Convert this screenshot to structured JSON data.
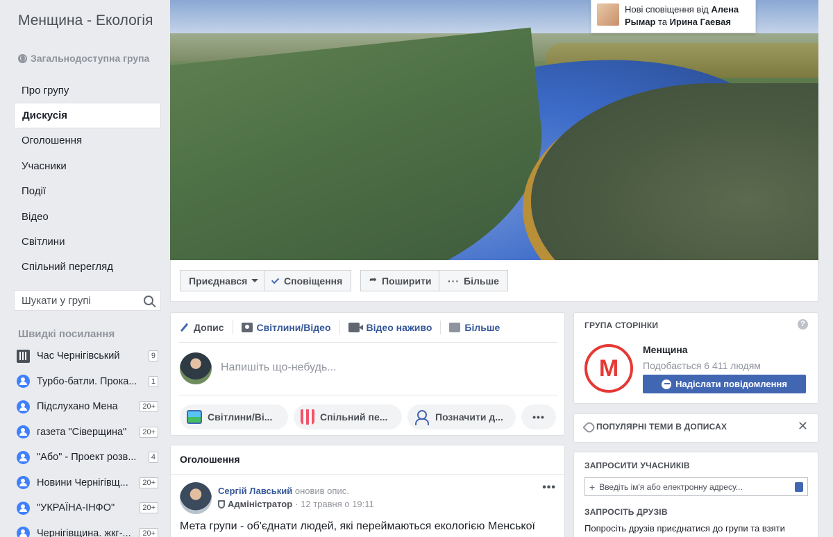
{
  "sidebar": {
    "group_title": "Менщина - Екологія",
    "privacy": "Загальнодоступна група",
    "nav": [
      {
        "label": "Про групу"
      },
      {
        "label": "Дискусія",
        "active": true
      },
      {
        "label": "Оголошення"
      },
      {
        "label": "Учасники"
      },
      {
        "label": "Події"
      },
      {
        "label": "Відео"
      },
      {
        "label": "Світлини"
      },
      {
        "label": "Спільний перегляд"
      }
    ],
    "search_placeholder": "Шукати у групі",
    "quick_links_title": "Швидкі посилання",
    "quick_links": [
      {
        "label": "Час Чернігівський",
        "badge": "9",
        "icon": "page-icon"
      },
      {
        "label": "Турбо-батли. Прока...",
        "badge": "1",
        "icon": "group-icon"
      },
      {
        "label": "Підслухано Мена",
        "badge": "20+",
        "icon": "group-icon"
      },
      {
        "label": "газета \"Сіверщина\"",
        "badge": "20+",
        "icon": "group-icon"
      },
      {
        "label": "\"Або\" - Проект розв...",
        "badge": "4",
        "icon": "group-icon"
      },
      {
        "label": "Новини Чернігівщ...",
        "badge": "20+",
        "icon": "group-icon"
      },
      {
        "label": "\"УКРАЇНА-ІНФО\"",
        "badge": "20+",
        "icon": "group-icon"
      },
      {
        "label": "Чернігівщина. жкг-...",
        "badge": "20+",
        "icon": "group-icon"
      }
    ]
  },
  "notification": {
    "prefix": "Нові сповіщення від ",
    "name1": "Алена Рымар",
    "joiner": " та ",
    "name2": "Ирина Гаевая"
  },
  "action_bar": {
    "joined": "Приєднався",
    "notifications": "Сповіщення",
    "share": "Поширити",
    "more": "Більше"
  },
  "composer": {
    "tabs": [
      "Допис",
      "Світлини/Відео",
      "Відео наживо",
      "Більше"
    ],
    "placeholder": "Напишіть що-небудь...",
    "pills": [
      "Світлини/Ві...",
      "Спільний пе...",
      "Позначити д..."
    ]
  },
  "announcements": {
    "title": "Оголошення",
    "post": {
      "author": "Сергій Лавський",
      "action": " оновив опис.",
      "role": "Адміністратор",
      "time": "· 12 травня о 19:11",
      "text": "Мета групи - об'єднати людей, які переймаються екологією Менської"
    }
  },
  "right": {
    "page_card": {
      "title": "ГРУПА СТОРІНКИ",
      "page_name": "Менщина",
      "likes": "Подобається 6 411 людям",
      "message_button": "Надіслати повідомлення",
      "logo_letter": "М"
    },
    "topics": {
      "title": "ПОПУЛЯРНІ ТЕМИ В ДОПИСАХ"
    },
    "invite": {
      "title": "ЗАПРОСИТИ УЧАСНИКІВ",
      "placeholder": "Введіть ім'я або електронну адресу...",
      "friends_title": "ЗАПРОСІТЬ ДРУЗІВ",
      "friends_desc": "Попросіть друзів приєднатися до групи та взяти"
    }
  },
  "colors": {
    "brand": "#4267b2",
    "link": "#365899",
    "logo_red": "#e53935",
    "background": "#e9ebee"
  }
}
